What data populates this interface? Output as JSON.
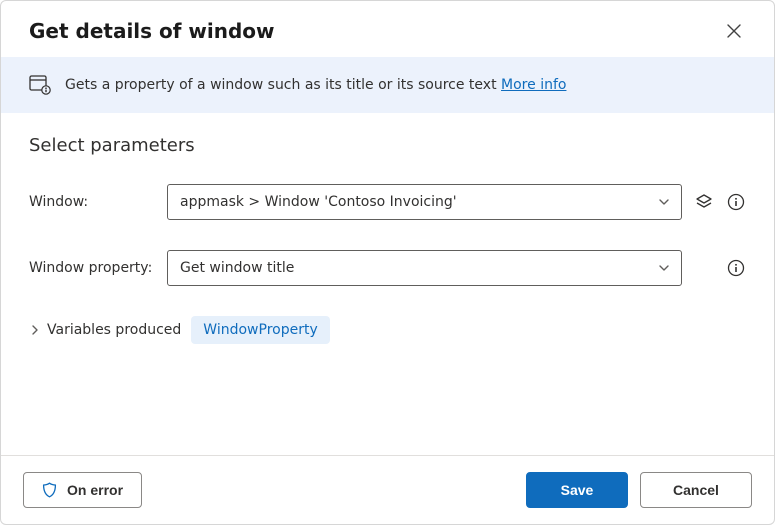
{
  "header": {
    "title": "Get details of window"
  },
  "banner": {
    "description": "Gets a property of a window such as its title or its source text",
    "more_info_label": "More info"
  },
  "section": {
    "title": "Select parameters"
  },
  "fields": {
    "window": {
      "label": "Window:",
      "value": "appmask > Window 'Contoso Invoicing'"
    },
    "window_property": {
      "label": "Window property:",
      "value": "Get window title"
    }
  },
  "variables": {
    "toggle_label": "Variables produced",
    "chip": "WindowProperty"
  },
  "footer": {
    "on_error": "On error",
    "save": "Save",
    "cancel": "Cancel"
  },
  "icons": {
    "close": "close-icon",
    "window": "window-icon",
    "chevron_down": "chevron-down-icon",
    "chevron_right": "chevron-right-icon",
    "layers": "layers-icon",
    "info": "info-icon",
    "shield": "shield-icon"
  }
}
